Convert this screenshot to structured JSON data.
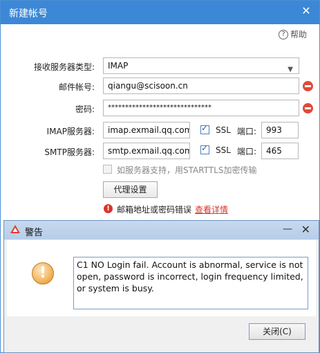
{
  "main": {
    "title": "新建帐号",
    "help": "帮助",
    "protocol": {
      "label": "接收服务器类型:",
      "value": "IMAP"
    },
    "account": {
      "label": "邮件帐号:",
      "value": "qiangu@scisoon.cn"
    },
    "password": {
      "label": "密码:",
      "value": "******************************"
    },
    "imap": {
      "label": "IMAP服务器:",
      "value": "imap.exmail.qq.com",
      "ssl": "SSL",
      "port_label": "端口:",
      "port": "993"
    },
    "smtp": {
      "label": "SMTP服务器:",
      "value": "smtp.exmail.qq.com",
      "ssl": "SSL",
      "port_label": "端口:",
      "port": "465"
    },
    "starttls": "如服务器支持，用STARTTLS加密传输",
    "proxy_button": "代理设置",
    "error_text": "邮箱地址或密码错误",
    "error_link": "查看详情"
  },
  "alert": {
    "title": "警告",
    "message": "C1 NO Login fail. Account is abnormal, service is not open, password is incorrect, login frequency limited, or system is busy.",
    "close_button": "关闭(C)"
  },
  "colors": {
    "title_bar": "#3c88d6",
    "error_red": "#d8352c",
    "warning_orange": "#f3b55d"
  }
}
